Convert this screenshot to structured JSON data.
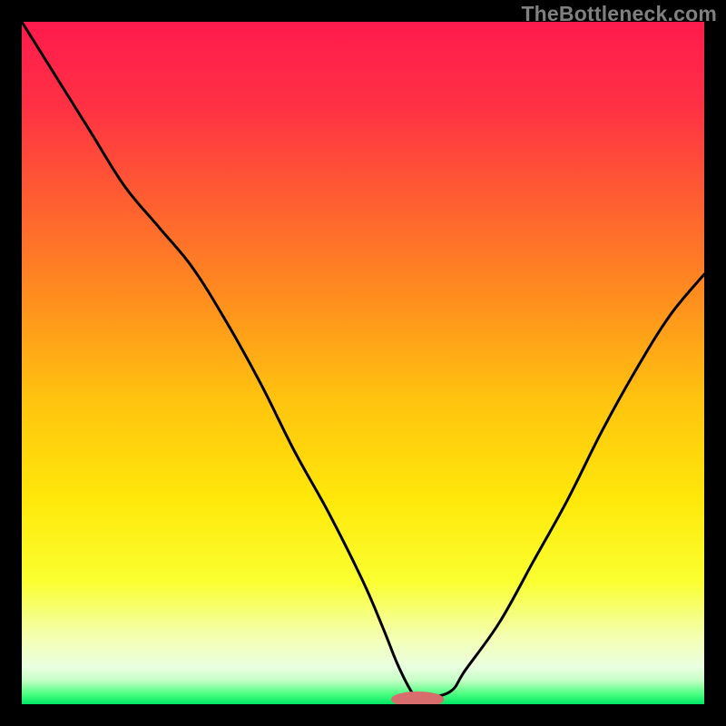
{
  "watermark": "TheBottleneck.com",
  "colors": {
    "frame": "#000000",
    "gradient_stops": [
      {
        "offset": 0.0,
        "color": "#ff1a4d"
      },
      {
        "offset": 0.12,
        "color": "#ff3044"
      },
      {
        "offset": 0.25,
        "color": "#ff5a33"
      },
      {
        "offset": 0.4,
        "color": "#ff8c1f"
      },
      {
        "offset": 0.55,
        "color": "#ffc20f"
      },
      {
        "offset": 0.7,
        "color": "#ffe80a"
      },
      {
        "offset": 0.82,
        "color": "#faff30"
      },
      {
        "offset": 0.9,
        "color": "#f4ffb0"
      },
      {
        "offset": 0.945,
        "color": "#eaffe0"
      },
      {
        "offset": 0.965,
        "color": "#c6ffc6"
      },
      {
        "offset": 0.985,
        "color": "#4cff80"
      },
      {
        "offset": 1.0,
        "color": "#00e765"
      }
    ],
    "curve": "#000000",
    "marker_fill": "#d86d6d",
    "marker_stroke": "#d86d6d"
  },
  "chart_data": {
    "type": "line",
    "title": "",
    "xlabel": "",
    "ylabel": "",
    "xlim": [
      0,
      100
    ],
    "ylim": [
      0,
      100
    ],
    "series": [
      {
        "name": "bottleneck-curve",
        "x": [
          0,
          5,
          10,
          15,
          20,
          25,
          30,
          35,
          40,
          45,
          50,
          53,
          55,
          57,
          58,
          60,
          63,
          65,
          70,
          75,
          80,
          85,
          90,
          95,
          100
        ],
        "y": [
          100,
          92,
          84,
          76,
          70,
          64,
          56,
          47,
          37,
          28,
          18,
          11,
          6,
          2,
          1,
          1,
          2,
          5,
          12,
          21,
          30,
          40,
          49,
          57,
          63
        ]
      }
    ],
    "marker": {
      "x": 58,
      "y": 0.7,
      "rx": 3.8,
      "ry": 1.1
    },
    "annotations": []
  }
}
